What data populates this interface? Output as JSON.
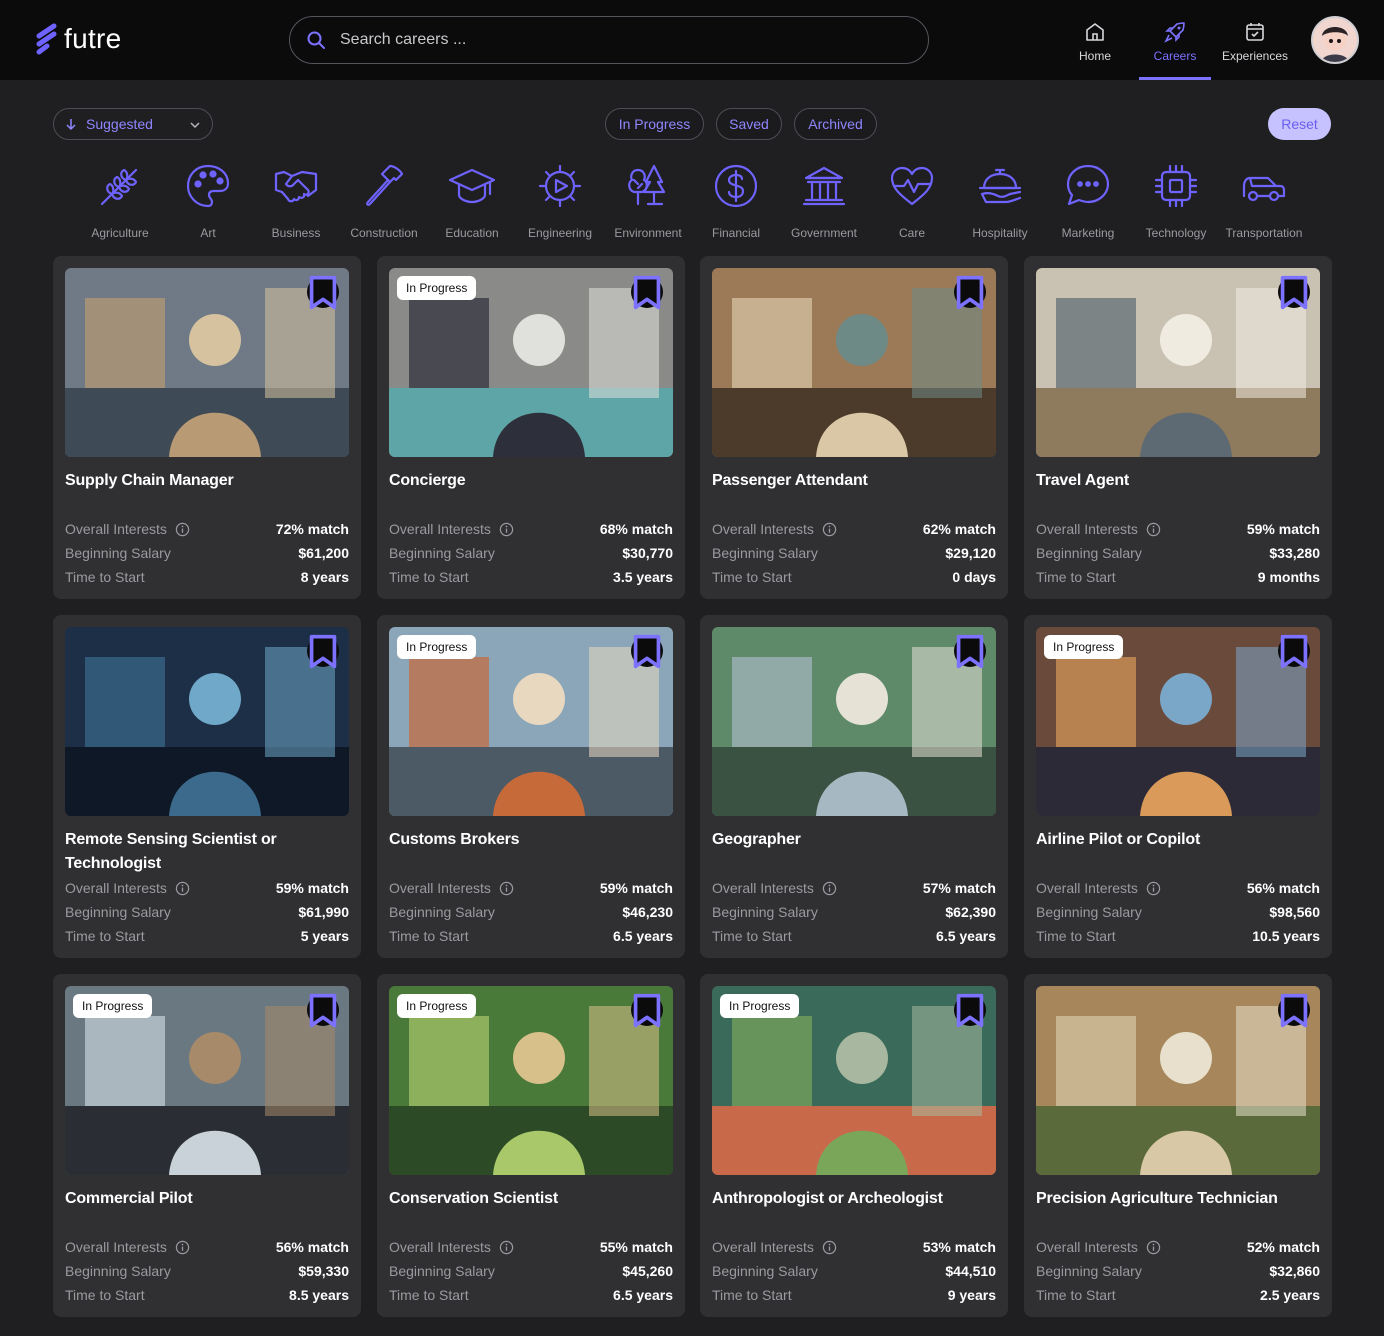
{
  "app": {
    "logo_text": "futre"
  },
  "search": {
    "placeholder": "Search careers ..."
  },
  "nav": [
    {
      "label": "Home",
      "icon": "home-icon",
      "active": false
    },
    {
      "label": "Careers",
      "icon": "rocket-icon",
      "active": true
    },
    {
      "label": "Experiences",
      "icon": "calendar-check-icon",
      "active": false
    }
  ],
  "filters": {
    "sort_label": "Suggested",
    "pills": [
      "In Progress",
      "Saved",
      "Archived"
    ],
    "reset_label": "Reset"
  },
  "categories": [
    {
      "label": "Agriculture",
      "icon": "wheat-icon"
    },
    {
      "label": "Art",
      "icon": "palette-icon"
    },
    {
      "label": "Business",
      "icon": "handshake-icon"
    },
    {
      "label": "Construction",
      "icon": "hammer-icon"
    },
    {
      "label": "Education",
      "icon": "graduation-cap-icon"
    },
    {
      "label": "Engineering",
      "icon": "gear-icon"
    },
    {
      "label": "Environment",
      "icon": "trees-icon"
    },
    {
      "label": "Financial",
      "icon": "dollar-circle-icon"
    },
    {
      "label": "Government",
      "icon": "landmark-icon"
    },
    {
      "label": "Care",
      "icon": "heart-pulse-icon"
    },
    {
      "label": "Hospitality",
      "icon": "service-bell-icon"
    },
    {
      "label": "Marketing",
      "icon": "chat-bubble-icon"
    },
    {
      "label": "Technology",
      "icon": "cpu-chip-icon"
    },
    {
      "label": "Transportation",
      "icon": "car-icon"
    }
  ],
  "card_labels": {
    "interests": "Overall Interests",
    "salary": "Beginning Salary",
    "time": "Time to Start"
  },
  "colors": {
    "accent": "#7c72ff",
    "card_bg": "#303032",
    "page_bg": "#1f1f21"
  },
  "careers": [
    {
      "title": "Supply Chain Manager",
      "in_progress": false,
      "match": "72% match",
      "salary": "$61,200",
      "time": "8 years"
    },
    {
      "title": "Concierge",
      "in_progress": true,
      "badge": "In Progress",
      "match": "68% match",
      "salary": "$30,770",
      "time": "3.5 years"
    },
    {
      "title": "Passenger Attendant",
      "in_progress": false,
      "match": "62% match",
      "salary": "$29,120",
      "time": "0 days"
    },
    {
      "title": "Travel Agent",
      "in_progress": false,
      "match": "59% match",
      "salary": "$33,280",
      "time": "9 months"
    },
    {
      "title": "Remote Sensing Scientist or Technologist",
      "in_progress": false,
      "match": "59% match",
      "salary": "$61,990",
      "time": "5 years"
    },
    {
      "title": "Customs Brokers",
      "in_progress": true,
      "badge": "In Progress",
      "match": "59% match",
      "salary": "$46,230",
      "time": "6.5 years"
    },
    {
      "title": "Geographer",
      "in_progress": false,
      "match": "57% match",
      "salary": "$62,390",
      "time": "6.5 years"
    },
    {
      "title": "Airline Pilot or Copilot",
      "in_progress": true,
      "badge": "In Progress",
      "match": "56% match",
      "salary": "$98,560",
      "time": "10.5 years"
    },
    {
      "title": "Commercial Pilot",
      "in_progress": true,
      "badge": "In Progress",
      "match": "56% match",
      "salary": "$59,330",
      "time": "8.5 years"
    },
    {
      "title": "Conservation Scientist",
      "in_progress": true,
      "badge": "In Progress",
      "match": "55% match",
      "salary": "$45,260",
      "time": "6.5 years"
    },
    {
      "title": "Anthropologist or Archeologist",
      "in_progress": true,
      "badge": "In Progress",
      "match": "53% match",
      "salary": "$44,510",
      "time": "9 years"
    },
    {
      "title": "Precision Agriculture Technician",
      "in_progress": false,
      "match": "52% match",
      "salary": "$32,860",
      "time": "2.5 years"
    }
  ]
}
